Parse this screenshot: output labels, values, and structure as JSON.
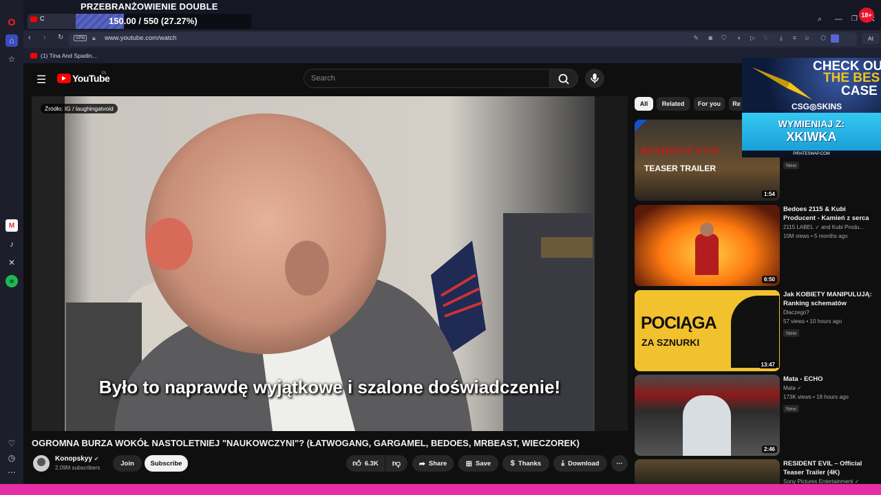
{
  "overlay": {
    "title": "PRZEBRANŻOWIENIE DOUBLE TROUBLE XDD",
    "progress_text": "150.00 / 550 (27.27%)",
    "progress_fraction": 0.2727
  },
  "browser": {
    "tab_letter": "C",
    "vpn_label": "VPN",
    "url": "www.youtube.com/watch",
    "ai_label": "AI",
    "bookmark": "(1) Tina And Spadin...",
    "age_badge": "18+"
  },
  "youtube": {
    "logo_text": "YouTube",
    "region": "PL",
    "search_placeholder": "Search"
  },
  "video": {
    "source_tag": "Źródło: IG / laughingatvoid",
    "subtitle": "Było to naprawdę wyjątkowe i szalone doświadczenie!",
    "title": "OGROMNA BURZA WOKÓŁ NASTOLETNIEJ \"NAUKOWCZYNI\"? (ŁATWOGANG, GARGAMEL, BEDOES, MRBEAST, WIECZOREK)",
    "channel": "Konopskyy",
    "subscribers": "2.09M subscribers",
    "join": "Join",
    "subscribe": "Subscribe",
    "likes": "6.3K",
    "share": "Share",
    "save": "Save",
    "thanks": "Thanks",
    "download": "Download"
  },
  "chips": [
    "All",
    "Related",
    "For you",
    "Re"
  ],
  "ad": {
    "line1": "CHECK OU",
    "line2": "THE BES",
    "line3": "CASE",
    "brand": "CSG◎SKINS",
    "promo1": "WYMIENIAJ Z:",
    "promo2": "XKIWKA",
    "site": "PIRATESWAP.COM"
  },
  "recommendations": [
    {
      "thumb_text1": "RESIDENT EVIL",
      "thumb_text2": "TEASER TRAILER",
      "duration": "1:54",
      "new": "New"
    },
    {
      "title": "Bedoes 2115 & Kubi Producent - Kamień z serca",
      "channel": "2115 LABEL ✓ and Kubi Produ...",
      "meta": "10M views • 5 months ago",
      "duration": "6:50"
    },
    {
      "title": "Jak KOBIETY MANIPULUJĄ: Ranking schematów",
      "channel": "Dlaczego?",
      "meta": "57 views • 10 hours ago",
      "new": "New",
      "thumb_text1": "POCIĄGA",
      "thumb_text2": "ZA SZNURKI",
      "duration": "13:47"
    },
    {
      "title": "Mata - ECHO",
      "channel": "Mata ✓",
      "meta": "173K views • 18 hours ago",
      "new": "New",
      "duration": "2:46"
    },
    {
      "title": "RESIDENT EVIL – Official Teaser Trailer (4K)",
      "channel": "Sony Pictures Entertainment ✓"
    }
  ]
}
